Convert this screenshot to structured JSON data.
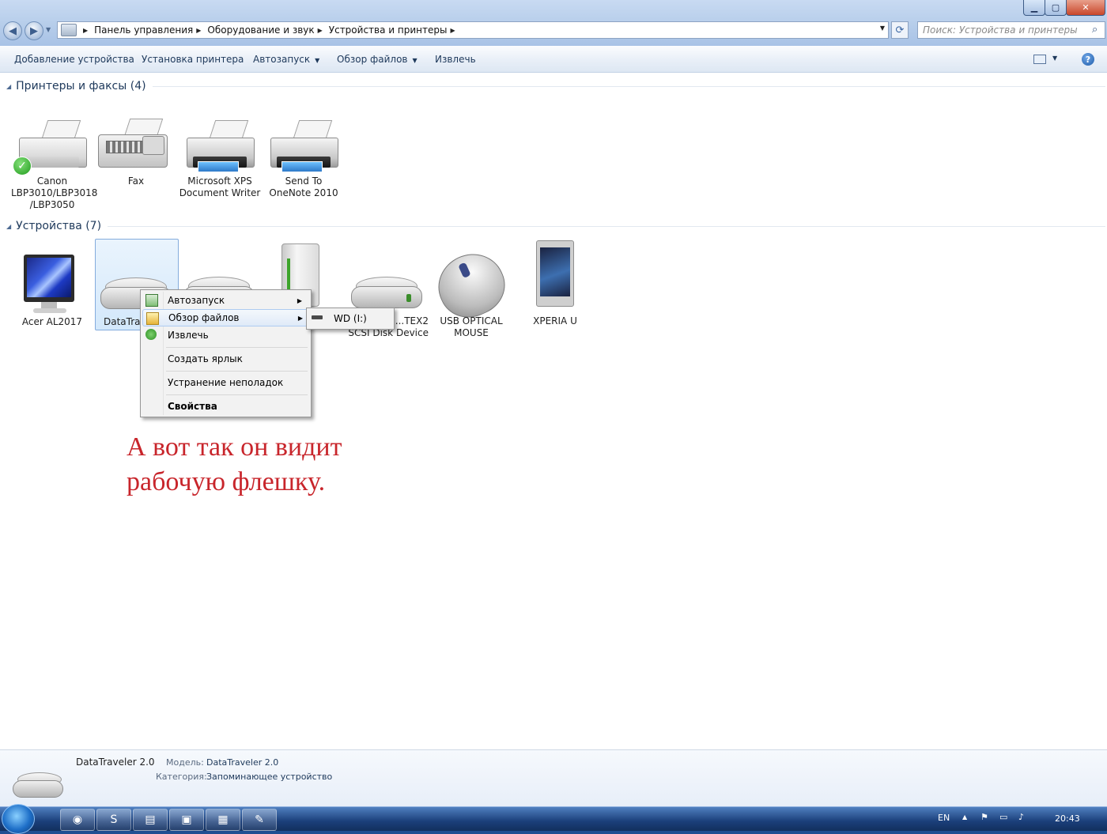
{
  "address": {
    "crumbs": [
      "Панель управления",
      "Оборудование и звук",
      "Устройства и принтеры"
    ],
    "search_placeholder": "Поиск: Устройства и принтеры"
  },
  "commands": {
    "add_device": "Добавление устройства",
    "add_printer": "Установка принтера",
    "autoplay": "Автозапуск",
    "browse": "Обзор файлов",
    "eject": "Извлечь"
  },
  "groups": {
    "printers": {
      "title": "Принтеры и факсы (4)",
      "items": [
        {
          "label": "Canon\nLBP3010/LBP3018\n/LBP3050",
          "icon": "printer-default-icon"
        },
        {
          "label": "Fax",
          "icon": "fax-icon"
        },
        {
          "label": "Microsoft XPS\nDocument Writer",
          "icon": "printer-icon"
        },
        {
          "label": "Send To\nOneNote 2010",
          "icon": "printer-icon"
        }
      ]
    },
    "devices": {
      "title": "Устройства (7)",
      "items": [
        {
          "label": "Acer AL2017",
          "icon": "monitor-icon"
        },
        {
          "label": "DataTrav",
          "icon": "usb-drive-icon"
        },
        {
          "label": "",
          "icon": "usb-drive-icon"
        },
        {
          "label": "",
          "icon": "external-disk-icon"
        },
        {
          "label": "...TEX2\nSCSI Disk Device",
          "icon": "disk-icon"
        },
        {
          "label": "USB OPTICAL\nMOUSE",
          "icon": "mouse-icon"
        },
        {
          "label": "XPERIA U",
          "icon": "phone-icon"
        }
      ]
    }
  },
  "context_menu": {
    "items": [
      "Автозапуск",
      "Обзор файлов",
      "Извлечь",
      "Создать ярлык",
      "Устранение неполадок",
      "Свойства"
    ],
    "submenu": [
      "WD (I:)"
    ]
  },
  "annotation": [
    "А вот так он видит",
    "рабочую флешку."
  ],
  "details": {
    "name": "DataTraveler 2.0",
    "model_key": "Модель:",
    "model_value": "DataTraveler 2.0",
    "category_key": "Категория:",
    "category_value": "Запоминающее устройство"
  },
  "taskbar": {
    "lang": "EN",
    "time": "20:43",
    "apps": [
      "chrome-icon",
      "skype-icon",
      "fax-app-icon",
      "network-app-icon",
      "explorer-icon",
      "paint-icon"
    ]
  },
  "colors": {
    "annotation": "#c8252b",
    "link": "#1e395b"
  }
}
